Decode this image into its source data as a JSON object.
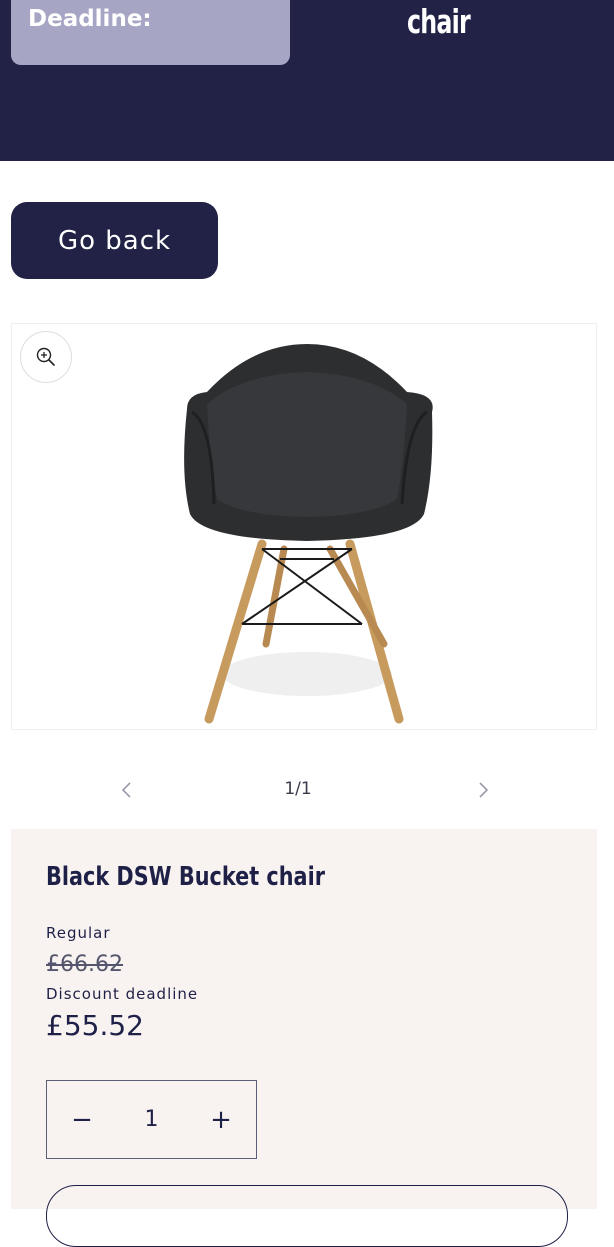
{
  "header": {
    "deadline_label": "Deadline:",
    "title_fragment": "chair"
  },
  "nav": {
    "go_back_label": "Go back"
  },
  "media": {
    "zoom_icon": "zoom-in-icon",
    "pager": {
      "count": "1/1",
      "prev_icon": "chevron-left-icon",
      "next_icon": "chevron-right-icon"
    }
  },
  "product": {
    "title": "Black DSW Bucket chair",
    "regular_label": "Regular",
    "regular_price": "£66.62",
    "discount_label": "Discount deadline",
    "sale_price": "£55.52",
    "quantity": {
      "value": "1",
      "minus_symbol": "−",
      "plus_symbol": "+"
    }
  },
  "colors": {
    "header_bg": "#212246",
    "deadline_box_bg": "#a6a5c4",
    "info_bg": "#f8f3f0",
    "text_primary": "#1f2047"
  }
}
